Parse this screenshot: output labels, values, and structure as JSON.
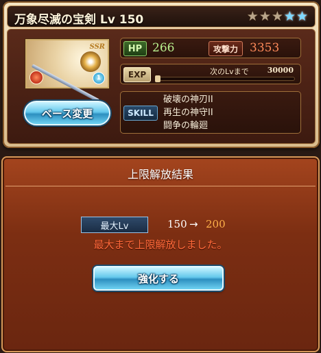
{
  "card": {
    "title": "万象尽滅の宝剣 Lv 150",
    "stars": [
      {
        "type": "bronze",
        "glyph": "★"
      },
      {
        "type": "bronze",
        "glyph": "★"
      },
      {
        "type": "bronze",
        "glyph": "★"
      },
      {
        "type": "blue",
        "glyph": "★"
      },
      {
        "type": "blue",
        "glyph": "★"
      }
    ],
    "portrait": {
      "rarity": "SSR",
      "element_icon": "fire-element-icon",
      "sub_icon": "water-skill-icon",
      "sub_icon_glyph": "1"
    },
    "base_button_label": "ベース変更",
    "hp_label": "HP",
    "hp_value": "266",
    "atk_label": "攻撃力",
    "atk_value": "3353",
    "exp_label": "EXP",
    "exp_next_label": "次のLvまで",
    "exp_next_value": "30000",
    "exp_progress": 0,
    "skill_label": "SKILL",
    "skills": [
      "破壊の神刃II",
      "再生の神守II",
      "闘争の輪廻"
    ]
  },
  "result": {
    "title": "上限解放結果",
    "max_lv_label": "最大Lv",
    "from_level": "150",
    "arrow": "→",
    "to_level": "200",
    "notice": "最大まで上限解放しました。",
    "enhance_button_label": "強化する"
  },
  "colors": {
    "accent_gold": "#d89a5a",
    "hp_green": "#b9f08e",
    "atk_orange": "#ff8a5a",
    "notice_red": "#ff6a3a",
    "level_to_orange": "#ffb24a",
    "button_blue": "#64c8ec"
  }
}
